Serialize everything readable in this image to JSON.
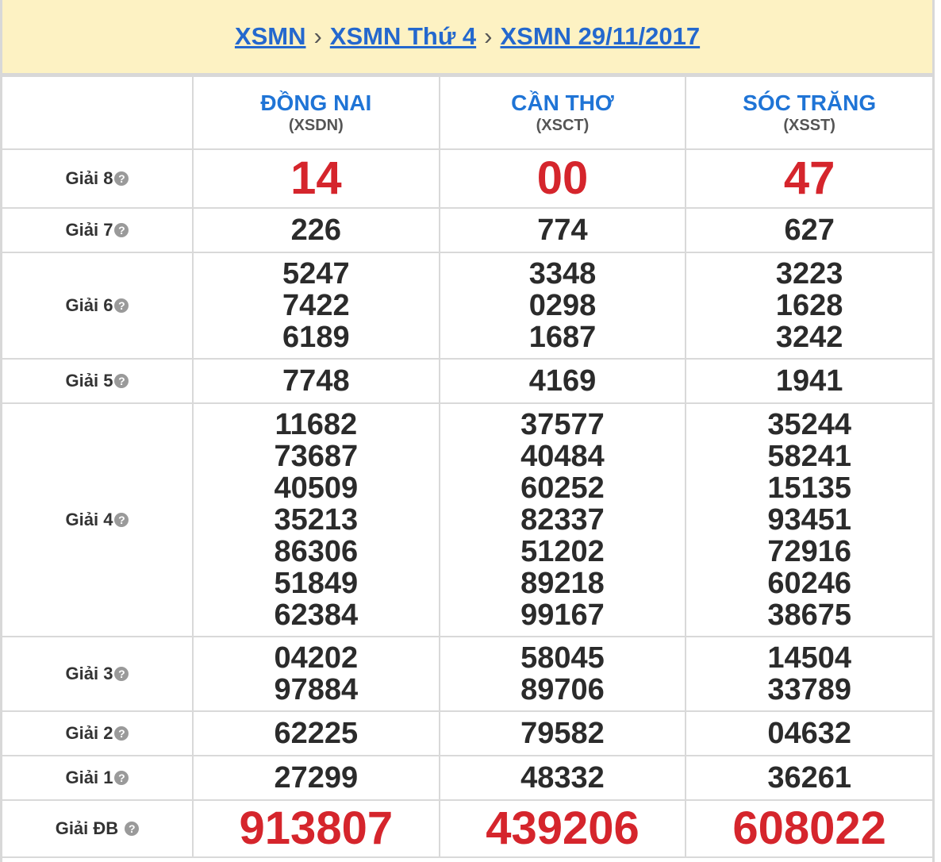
{
  "breadcrumb": {
    "items": [
      "XSMN",
      "XSMN Thứ 4",
      "XSMN 29/11/2017"
    ],
    "separator": "›"
  },
  "provinces": [
    {
      "name": "ĐỒNG NAI",
      "code": "(XSDN)"
    },
    {
      "name": "CẦN THƠ",
      "code": "(XSCT)"
    },
    {
      "name": "SÓC TRĂNG",
      "code": "(XSST)"
    }
  ],
  "prizes": [
    {
      "label": "Giải 8",
      "values": [
        [
          "14"
        ],
        [
          "00"
        ],
        [
          "47"
        ]
      ]
    },
    {
      "label": "Giải 7",
      "values": [
        [
          "226"
        ],
        [
          "774"
        ],
        [
          "627"
        ]
      ]
    },
    {
      "label": "Giải 6",
      "values": [
        [
          "5247",
          "7422",
          "6189"
        ],
        [
          "3348",
          "0298",
          "1687"
        ],
        [
          "3223",
          "1628",
          "3242"
        ]
      ]
    },
    {
      "label": "Giải 5",
      "values": [
        [
          "7748"
        ],
        [
          "4169"
        ],
        [
          "1941"
        ]
      ]
    },
    {
      "label": "Giải 4",
      "values": [
        [
          "11682",
          "73687",
          "40509",
          "35213",
          "86306",
          "51849",
          "62384"
        ],
        [
          "37577",
          "40484",
          "60252",
          "82337",
          "51202",
          "89218",
          "99167"
        ],
        [
          "35244",
          "58241",
          "15135",
          "93451",
          "72916",
          "60246",
          "38675"
        ]
      ]
    },
    {
      "label": "Giải 3",
      "values": [
        [
          "04202",
          "97884"
        ],
        [
          "58045",
          "89706"
        ],
        [
          "14504",
          "33789"
        ]
      ]
    },
    {
      "label": "Giải 2",
      "values": [
        [
          "62225"
        ],
        [
          "79582"
        ],
        [
          "04632"
        ]
      ]
    },
    {
      "label": "Giải 1",
      "values": [
        [
          "27299"
        ],
        [
          "48332"
        ],
        [
          "36261"
        ]
      ]
    },
    {
      "label": "Giải ĐB",
      "values": [
        [
          "913807"
        ],
        [
          "439206"
        ],
        [
          "608022"
        ]
      ]
    }
  ],
  "help_icon": "question-circle-icon",
  "colors": {
    "link": "#2468ce",
    "province": "#1f74d6",
    "highlight": "#d5252c",
    "header_bg": "#fdf2c3"
  }
}
